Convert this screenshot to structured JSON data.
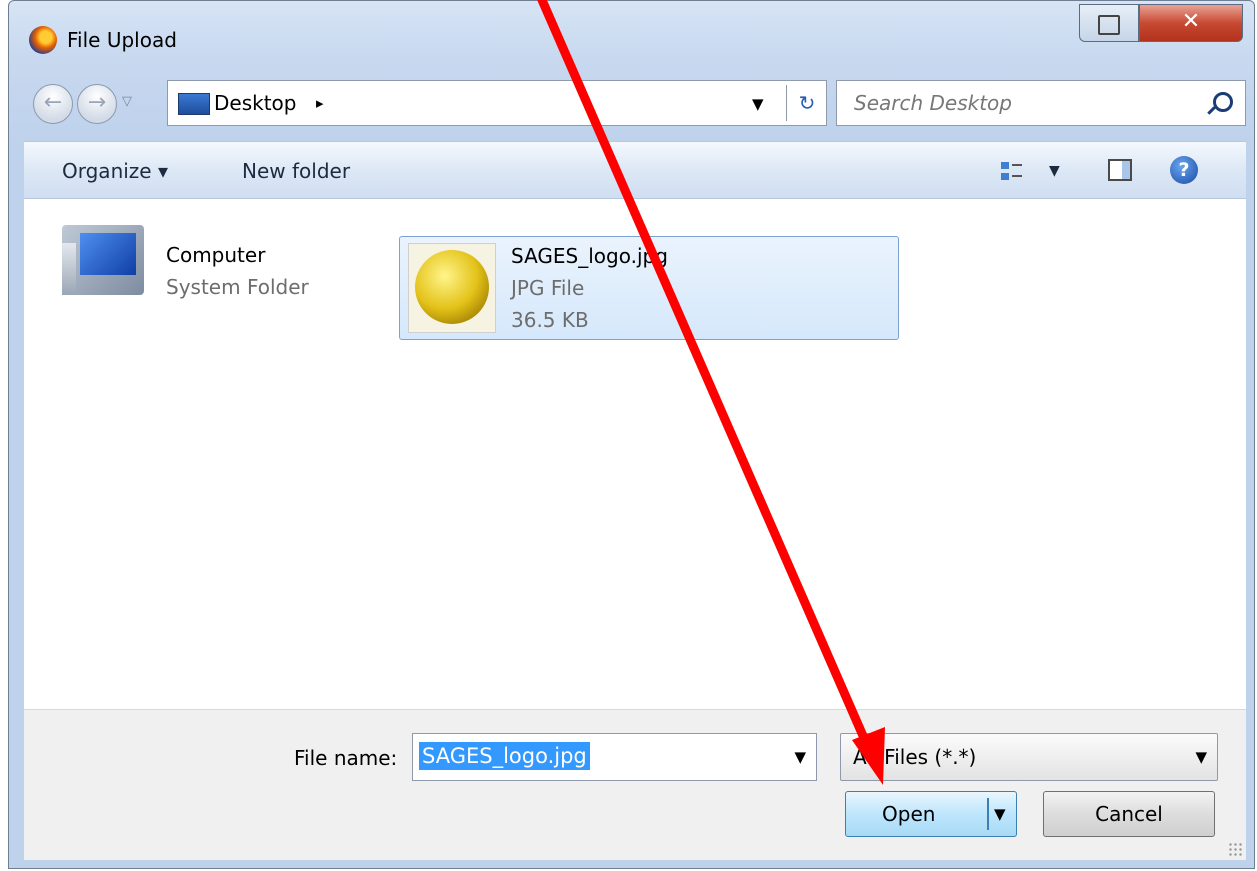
{
  "window": {
    "title": "File Upload"
  },
  "navigation": {
    "address": "Desktop",
    "address_chevron": "▸",
    "search_placeholder": "Search Desktop"
  },
  "toolbar": {
    "organize_label": "Organize ▾",
    "new_folder_label": "New folder"
  },
  "items": [
    {
      "name": "Computer",
      "type": "System Folder",
      "icon": "computer-icon"
    },
    {
      "name": "SAGES_logo.jpg",
      "type": "JPG File",
      "size": "36.5 KB",
      "icon": "image-thumbnail",
      "selected": true
    }
  ],
  "footer": {
    "file_name_label": "File name:",
    "file_name_value": "SAGES_logo.jpg",
    "file_type_value": "All Files (*.*)",
    "open_label": "Open",
    "cancel_label": "Cancel"
  },
  "annotation": {
    "type": "red-arrow",
    "color": "#ff0000",
    "points_to": "open-button"
  },
  "colors": {
    "selection": "#3399ff",
    "close_button": "#c74a33",
    "open_button": "#bee6fd"
  }
}
